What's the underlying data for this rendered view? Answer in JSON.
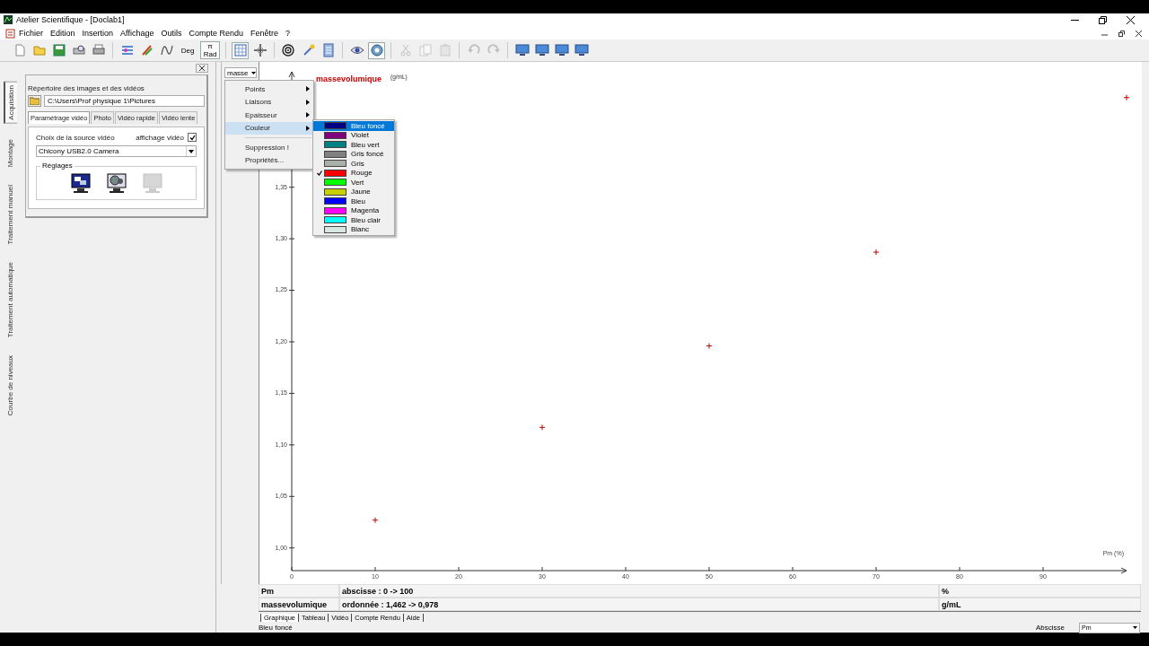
{
  "window": {
    "title": "Atelier Scientifique - [Doclab1]"
  },
  "menu_bar": [
    "Fichier",
    "Edition",
    "Insertion",
    "Affichage",
    "Outils",
    "Compte Rendu",
    "Fenêtre",
    "?"
  ],
  "toolbar": [
    {
      "kind": "new",
      "pressed": false,
      "disabled": false
    },
    {
      "kind": "open",
      "pressed": false,
      "disabled": false
    },
    {
      "kind": "save",
      "pressed": false,
      "disabled": false
    },
    {
      "kind": "preview",
      "pressed": false,
      "disabled": false
    },
    {
      "kind": "print",
      "pressed": false,
      "disabled": false
    },
    {
      "kind": "separator"
    },
    {
      "kind": "data",
      "pressed": false,
      "disabled": false
    },
    {
      "kind": "pen",
      "pressed": false,
      "disabled": false
    },
    {
      "kind": "curve",
      "pressed": false,
      "disabled": false
    },
    {
      "kind": "text",
      "label": "Deg",
      "pressed": false,
      "disabled": false
    },
    {
      "kind": "text",
      "top": "π",
      "label": "Rad",
      "pressed": true,
      "disabled": false
    },
    {
      "kind": "separator"
    },
    {
      "kind": "grid",
      "pressed": true,
      "disabled": false
    },
    {
      "kind": "cross",
      "pressed": false,
      "disabled": false
    },
    {
      "kind": "separator"
    },
    {
      "kind": "target",
      "pressed": false,
      "disabled": false
    },
    {
      "kind": "wand",
      "pressed": false,
      "disabled": false
    },
    {
      "kind": "sheet",
      "pressed": false,
      "disabled": false
    },
    {
      "kind": "separator"
    },
    {
      "kind": "eye",
      "pressed": false,
      "disabled": false
    },
    {
      "kind": "camera",
      "pressed": true,
      "disabled": false
    },
    {
      "kind": "separator"
    },
    {
      "kind": "cut",
      "pressed": false,
      "disabled": true
    },
    {
      "kind": "copy",
      "pressed": false,
      "disabled": true
    },
    {
      "kind": "paste",
      "pressed": false,
      "disabled": true
    },
    {
      "kind": "separator"
    },
    {
      "kind": "undo",
      "pressed": false,
      "disabled": true
    },
    {
      "kind": "redo",
      "pressed": false,
      "disabled": true
    },
    {
      "kind": "separator"
    },
    {
      "kind": "monitor",
      "pressed": false,
      "disabled": false
    },
    {
      "kind": "monitor",
      "pressed": false,
      "disabled": false
    },
    {
      "kind": "monitor",
      "pressed": false,
      "disabled": false
    },
    {
      "kind": "monitor",
      "pressed": false,
      "disabled": false
    }
  ],
  "side_tabs": [
    {
      "label": "Acquisition",
      "selected": true
    },
    {
      "label": "Montage",
      "selected": false
    },
    {
      "label": "Traitement manuel",
      "selected": false
    },
    {
      "label": "Traitement automatique",
      "selected": false
    },
    {
      "label": "Courbe de niveaux",
      "selected": false
    }
  ],
  "acquisition": {
    "folder_label": "Répertoire des images et des vidéos",
    "folder_path": "C:\\Users\\Prof physique 1\\Pictures",
    "tabs": [
      {
        "label": "Paramétrage vidéo",
        "selected": true
      },
      {
        "label": "Photo",
        "selected": false
      },
      {
        "label": "Vidéo rapide",
        "selected": false
      },
      {
        "label": "Vidéo lente",
        "selected": false
      }
    ],
    "source_label": "Choix de la source vidéo",
    "video_display": {
      "label": "affichage vidéo",
      "checked": true
    },
    "source": "Chicony USB2.0 Camera",
    "settings_group": "Réglages",
    "settings_buttons": [
      {
        "kind": "display",
        "disabled": false
      },
      {
        "kind": "camera",
        "disabled": false
      },
      {
        "kind": "blank",
        "disabled": true
      }
    ]
  },
  "curve_selector": {
    "value": "masse"
  },
  "context_menu": [
    {
      "kind": "item",
      "label": "Points",
      "submenu": true,
      "highlighted": false
    },
    {
      "kind": "item",
      "label": "Liaisons",
      "submenu": true,
      "highlighted": false
    },
    {
      "kind": "item",
      "label": "Epaisseur",
      "submenu": true,
      "highlighted": false
    },
    {
      "kind": "item",
      "label": "Couleur",
      "submenu": true,
      "highlighted": true
    },
    {
      "kind": "separator"
    },
    {
      "kind": "item",
      "label": "Suppression !",
      "submenu": false,
      "highlighted": false
    },
    {
      "kind": "item",
      "label": "Propriétés...",
      "submenu": false,
      "highlighted": false
    }
  ],
  "color_submenu": [
    {
      "label": "Bleu foncé",
      "color": "#000080",
      "checked": false,
      "highlighted": true
    },
    {
      "label": "Violet",
      "color": "#800080",
      "checked": false,
      "highlighted": false
    },
    {
      "label": "Bleu vert",
      "color": "#008080",
      "checked": false,
      "highlighted": false
    },
    {
      "label": "Gris foncé",
      "color": "#808080",
      "checked": false,
      "highlighted": false
    },
    {
      "label": "Gris",
      "color": "#a8b0a8",
      "checked": false,
      "highlighted": false
    },
    {
      "label": "Rouge",
      "color": "#ff0000",
      "checked": true,
      "highlighted": false
    },
    {
      "label": "Vert",
      "color": "#00ff00",
      "checked": false,
      "highlighted": false
    },
    {
      "label": "Jaune",
      "color": "#c8d000",
      "checked": false,
      "highlighted": false
    },
    {
      "label": "Bleu",
      "color": "#0000ff",
      "checked": false,
      "highlighted": false
    },
    {
      "label": "Magenta",
      "color": "#ff00ff",
      "checked": false,
      "highlighted": false
    },
    {
      "label": "Bleu clair",
      "color": "#00ffff",
      "checked": false,
      "highlighted": false
    },
    {
      "label": "Blanc",
      "color": "#d8e8e0",
      "checked": false,
      "highlighted": false
    }
  ],
  "graph": {
    "chart_data": {
      "type": "scatter",
      "title": "massevolumique",
      "ylabel": "(g/mL)",
      "xlabel": "Pm (%)",
      "series": [
        {
          "color": "#c00000",
          "x": [
            10,
            30,
            50,
            70,
            100
          ],
          "values": [
            1.027,
            1.117,
            1.196,
            1.287,
            1.437
          ]
        }
      ],
      "xlim": [
        0,
        100
      ],
      "ylim": [
        0.978,
        1.462
      ],
      "xticks": [
        0,
        10,
        20,
        30,
        40,
        50,
        60,
        70,
        80,
        90
      ],
      "yticks": [
        {
          "value": 1.0,
          "label": "1,00"
        },
        {
          "value": 1.05,
          "label": "1,05"
        },
        {
          "value": 1.1,
          "label": "1,10"
        },
        {
          "value": 1.15,
          "label": "1,15"
        },
        {
          "value": 1.2,
          "label": "1,20"
        },
        {
          "value": 1.25,
          "label": "1,25"
        },
        {
          "value": 1.3,
          "label": "1,30"
        },
        {
          "value": 1.35,
          "label": "1,35"
        }
      ]
    }
  },
  "info_table": {
    "rows": [
      [
        "Pm",
        "abscisse : 0 -> 100",
        "%"
      ],
      [
        "massevolumique",
        "ordonnée : 1,462 -> 0,978",
        "g/mL"
      ]
    ]
  },
  "view_tabs": [
    {
      "label": "Graphique",
      "selected": true
    },
    {
      "label": "Tableau",
      "selected": false
    },
    {
      "label": "Vidéo",
      "selected": false
    },
    {
      "label": "Compte Rendu",
      "selected": false
    },
    {
      "label": "Aide",
      "selected": false
    }
  ],
  "status_bar": {
    "message": "Bleu foncé",
    "axis_label": "Abscisse",
    "axis_value": "Pm"
  }
}
